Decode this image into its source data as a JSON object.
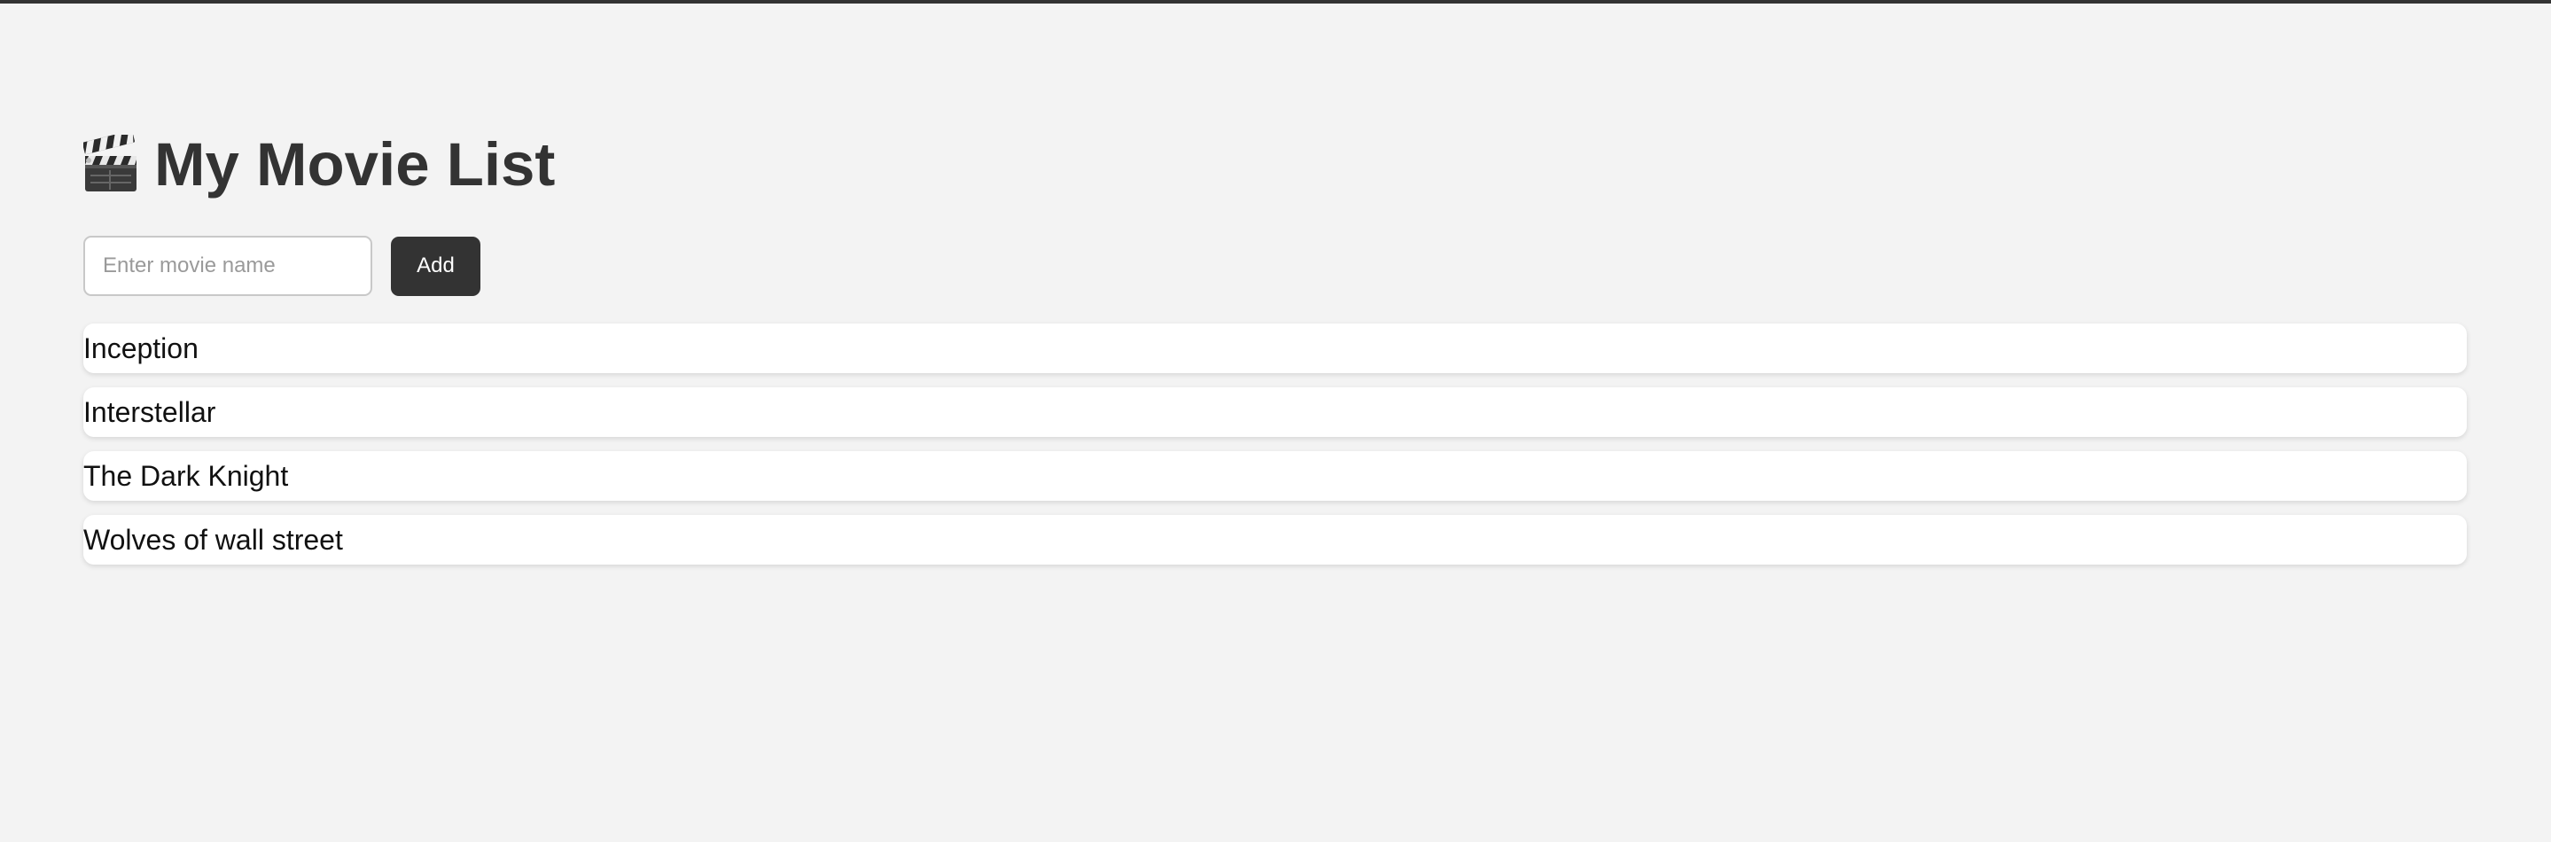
{
  "header": {
    "icon": "clapper-board-icon",
    "title": "My Movie List"
  },
  "form": {
    "input_placeholder": "Enter movie name",
    "input_value": "",
    "add_label": "Add"
  },
  "movies": [
    "Inception",
    "Interstellar",
    "The Dark Knight",
    "Wolves of wall street"
  ],
  "colors": {
    "background": "#f3f3f3",
    "accent": "#333333",
    "card": "#ffffff"
  }
}
